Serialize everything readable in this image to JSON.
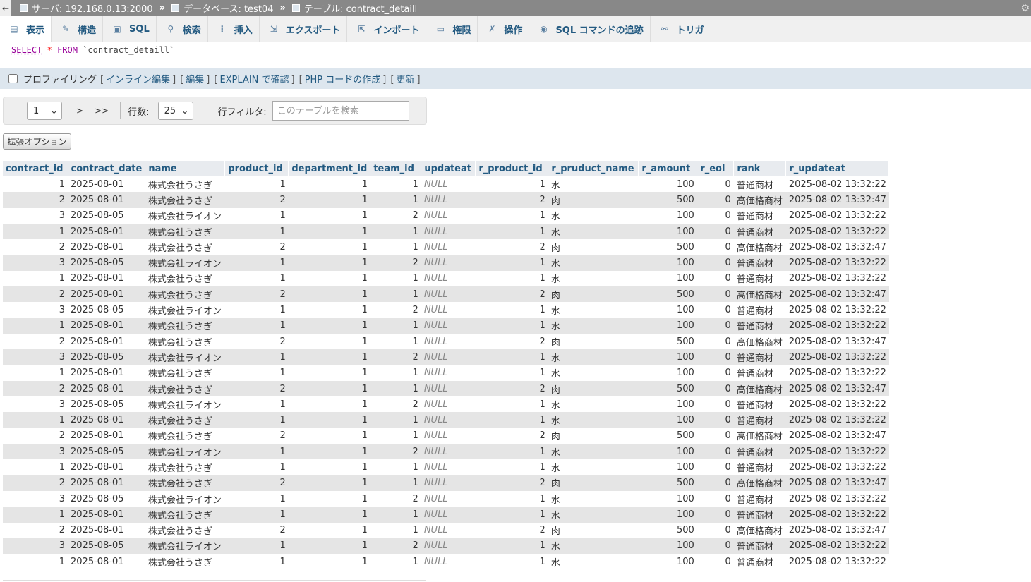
{
  "breadcrumb": {
    "server": "サーバ: 192.168.0.13:2000",
    "database": "データベース: test04",
    "table": "テーブル: contract_detaill",
    "separator": "»"
  },
  "tabs": [
    {
      "label": "表示",
      "icon": "browse-icon"
    },
    {
      "label": "構造",
      "icon": "structure-icon"
    },
    {
      "label": "SQL",
      "icon": "sql-icon"
    },
    {
      "label": "検索",
      "icon": "search-icon"
    },
    {
      "label": "挿入",
      "icon": "insert-icon"
    },
    {
      "label": "エクスポート",
      "icon": "export-icon"
    },
    {
      "label": "インポート",
      "icon": "import-icon"
    },
    {
      "label": "権限",
      "icon": "privileges-icon"
    },
    {
      "label": "操作",
      "icon": "wrench-icon"
    },
    {
      "label": "SQL コマンドの追跡",
      "icon": "eye-icon"
    },
    {
      "label": "トリガ",
      "icon": "triggers-icon"
    }
  ],
  "sql": {
    "select": "SELECT",
    "star": "*",
    "from": "FROM",
    "table": "`contract_detaill`"
  },
  "profiling": {
    "label": "プロファイリング",
    "links": [
      "インライン編集",
      "編集",
      "EXPLAIN で確認",
      "PHP コードの作成",
      "更新"
    ]
  },
  "nav": {
    "page_value": "1",
    "next": ">",
    "last": ">>",
    "rows_label": "行数:",
    "rows_value": "25",
    "filter_label": "行フィルタ:",
    "filter_placeholder": "このテーブルを検索"
  },
  "extended_options": "拡張オプション",
  "null_text": "NULL",
  "table": {
    "columns": [
      "contract_id",
      "contract_date",
      "name",
      "product_id",
      "department_id",
      "team_id",
      "updateat",
      "r_product_id",
      "r_pruduct_name",
      "r_amount",
      "r_eol",
      "rank",
      "r_updateat"
    ],
    "rows": [
      [
        "1",
        "2025-08-01",
        "株式会社うさぎ",
        "1",
        "1",
        "1",
        "NULL",
        "1",
        "水",
        "100",
        "0",
        "普通商材",
        "2025-08-02 13:32:22"
      ],
      [
        "2",
        "2025-08-01",
        "株式会社うさぎ",
        "2",
        "1",
        "1",
        "NULL",
        "2",
        "肉",
        "500",
        "0",
        "高価格商材",
        "2025-08-02 13:32:47"
      ],
      [
        "3",
        "2025-08-05",
        "株式会社ライオン",
        "1",
        "1",
        "2",
        "NULL",
        "1",
        "水",
        "100",
        "0",
        "普通商材",
        "2025-08-02 13:32:22"
      ],
      [
        "1",
        "2025-08-01",
        "株式会社うさぎ",
        "1",
        "1",
        "1",
        "NULL",
        "1",
        "水",
        "100",
        "0",
        "普通商材",
        "2025-08-02 13:32:22"
      ],
      [
        "2",
        "2025-08-01",
        "株式会社うさぎ",
        "2",
        "1",
        "1",
        "NULL",
        "2",
        "肉",
        "500",
        "0",
        "高価格商材",
        "2025-08-02 13:32:47"
      ],
      [
        "3",
        "2025-08-05",
        "株式会社ライオン",
        "1",
        "1",
        "2",
        "NULL",
        "1",
        "水",
        "100",
        "0",
        "普通商材",
        "2025-08-02 13:32:22"
      ],
      [
        "1",
        "2025-08-01",
        "株式会社うさぎ",
        "1",
        "1",
        "1",
        "NULL",
        "1",
        "水",
        "100",
        "0",
        "普通商材",
        "2025-08-02 13:32:22"
      ],
      [
        "2",
        "2025-08-01",
        "株式会社うさぎ",
        "2",
        "1",
        "1",
        "NULL",
        "2",
        "肉",
        "500",
        "0",
        "高価格商材",
        "2025-08-02 13:32:47"
      ],
      [
        "3",
        "2025-08-05",
        "株式会社ライオン",
        "1",
        "1",
        "2",
        "NULL",
        "1",
        "水",
        "100",
        "0",
        "普通商材",
        "2025-08-02 13:32:22"
      ],
      [
        "1",
        "2025-08-01",
        "株式会社うさぎ",
        "1",
        "1",
        "1",
        "NULL",
        "1",
        "水",
        "100",
        "0",
        "普通商材",
        "2025-08-02 13:32:22"
      ],
      [
        "2",
        "2025-08-01",
        "株式会社うさぎ",
        "2",
        "1",
        "1",
        "NULL",
        "2",
        "肉",
        "500",
        "0",
        "高価格商材",
        "2025-08-02 13:32:47"
      ],
      [
        "3",
        "2025-08-05",
        "株式会社ライオン",
        "1",
        "1",
        "2",
        "NULL",
        "1",
        "水",
        "100",
        "0",
        "普通商材",
        "2025-08-02 13:32:22"
      ],
      [
        "1",
        "2025-08-01",
        "株式会社うさぎ",
        "1",
        "1",
        "1",
        "NULL",
        "1",
        "水",
        "100",
        "0",
        "普通商材",
        "2025-08-02 13:32:22"
      ],
      [
        "2",
        "2025-08-01",
        "株式会社うさぎ",
        "2",
        "1",
        "1",
        "NULL",
        "2",
        "肉",
        "500",
        "0",
        "高価格商材",
        "2025-08-02 13:32:47"
      ],
      [
        "3",
        "2025-08-05",
        "株式会社ライオン",
        "1",
        "1",
        "2",
        "NULL",
        "1",
        "水",
        "100",
        "0",
        "普通商材",
        "2025-08-02 13:32:22"
      ],
      [
        "1",
        "2025-08-01",
        "株式会社うさぎ",
        "1",
        "1",
        "1",
        "NULL",
        "1",
        "水",
        "100",
        "0",
        "普通商材",
        "2025-08-02 13:32:22"
      ],
      [
        "2",
        "2025-08-01",
        "株式会社うさぎ",
        "2",
        "1",
        "1",
        "NULL",
        "2",
        "肉",
        "500",
        "0",
        "高価格商材",
        "2025-08-02 13:32:47"
      ],
      [
        "3",
        "2025-08-05",
        "株式会社ライオン",
        "1",
        "1",
        "2",
        "NULL",
        "1",
        "水",
        "100",
        "0",
        "普通商材",
        "2025-08-02 13:32:22"
      ],
      [
        "1",
        "2025-08-01",
        "株式会社うさぎ",
        "1",
        "1",
        "1",
        "NULL",
        "1",
        "水",
        "100",
        "0",
        "普通商材",
        "2025-08-02 13:32:22"
      ],
      [
        "2",
        "2025-08-01",
        "株式会社うさぎ",
        "2",
        "1",
        "1",
        "NULL",
        "2",
        "肉",
        "500",
        "0",
        "高価格商材",
        "2025-08-02 13:32:47"
      ],
      [
        "3",
        "2025-08-05",
        "株式会社ライオン",
        "1",
        "1",
        "2",
        "NULL",
        "1",
        "水",
        "100",
        "0",
        "普通商材",
        "2025-08-02 13:32:22"
      ],
      [
        "1",
        "2025-08-01",
        "株式会社うさぎ",
        "1",
        "1",
        "1",
        "NULL",
        "1",
        "水",
        "100",
        "0",
        "普通商材",
        "2025-08-02 13:32:22"
      ],
      [
        "2",
        "2025-08-01",
        "株式会社うさぎ",
        "2",
        "1",
        "1",
        "NULL",
        "2",
        "肉",
        "500",
        "0",
        "高価格商材",
        "2025-08-02 13:32:47"
      ],
      [
        "3",
        "2025-08-05",
        "株式会社ライオン",
        "1",
        "1",
        "2",
        "NULL",
        "1",
        "水",
        "100",
        "0",
        "普通商材",
        "2025-08-02 13:32:22"
      ],
      [
        "1",
        "2025-08-01",
        "株式会社うさぎ",
        "1",
        "1",
        "1",
        "NULL",
        "1",
        "水",
        "100",
        "0",
        "普通商材",
        "2025-08-02 13:32:22"
      ]
    ]
  }
}
